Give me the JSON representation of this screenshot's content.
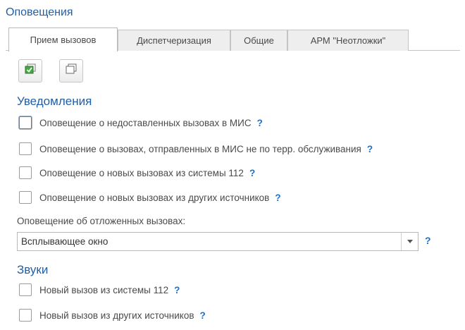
{
  "page": {
    "title": "Оповещения"
  },
  "tabs": [
    {
      "label": "Прием вызовов",
      "active": true
    },
    {
      "label": "Диспетчеризация",
      "active": false
    },
    {
      "label": "Общие",
      "active": false
    },
    {
      "label": "АРМ \"Неотложки\"",
      "active": false
    }
  ],
  "toolbar": {
    "buttons": [
      {
        "icon": "check-all-icon"
      },
      {
        "icon": "uncheck-all-icon"
      }
    ]
  },
  "notifications": {
    "title": "Уведомления",
    "items": [
      {
        "label": "Оповещение о недоставленных вызовах в МИС",
        "checked": false,
        "help": "?"
      },
      {
        "label": "Оповещение о вызовах, отправленных в МИС не по терр. обслуживания",
        "checked": false,
        "help": "?"
      },
      {
        "label": "Оповещение о новых вызовах из системы 112",
        "checked": false,
        "help": "?"
      },
      {
        "label": "Оповещение о новых вызовах из других источников",
        "checked": false,
        "help": "?"
      }
    ],
    "deferred": {
      "label": "Оповещение об отложенных вызовах:",
      "value": "Всплывающее окно",
      "help": "?"
    }
  },
  "sounds": {
    "title": "Звуки",
    "items": [
      {
        "label": "Новый вызов из системы 112",
        "checked": false,
        "help": "?"
      },
      {
        "label": "Новый вызов из других источников",
        "checked": false,
        "help": "?"
      }
    ]
  },
  "colors": {
    "accent": "#1e5fa8",
    "help": "#1e6fc8",
    "text": "#4a4a4a",
    "border": "#c4c4c4"
  }
}
